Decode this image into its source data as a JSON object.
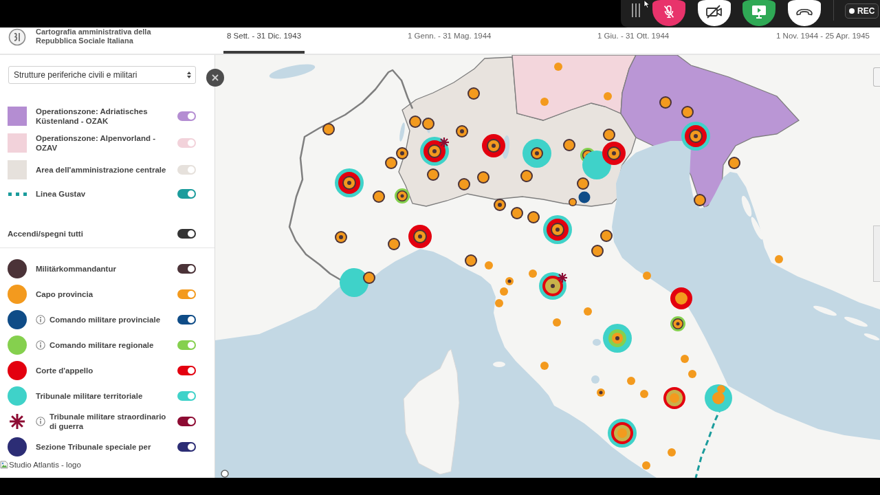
{
  "meeting_toolbar": {
    "mic_muted": true,
    "camera_on": false,
    "screen_sharing": true,
    "recording_label": "REC"
  },
  "header": {
    "title": "Cartografia amministrativa della Repubblica Sociale Italiana",
    "tabs": [
      {
        "label": "8 Sett. - 31 Dic. 1943",
        "selected": true
      },
      {
        "label": "1 Genn. - 31 Mag. 1944",
        "selected": false
      },
      {
        "label": "1 Giu. - 31 Ott. 1944",
        "selected": false
      },
      {
        "label": "1 Nov. 1944 - 25 Apr. 1945",
        "selected": false
      }
    ]
  },
  "sidebar": {
    "dropdown": {
      "value": "Strutture periferiche civili e militari"
    },
    "zones": [
      {
        "kind": "swatch",
        "label": "Operationszone: Adriatisches Küstenland - OZAK",
        "color": "#b48dd2",
        "on": true
      },
      {
        "kind": "swatch",
        "label": "Operationszone: Alpenvorland - OZAV",
        "color": "#f2d2da",
        "on": true
      },
      {
        "kind": "swatch",
        "label": "Area dell'amministrazione centrale",
        "color": "#e6e1dc",
        "on": true
      },
      {
        "kind": "dashes",
        "label": "Linea Gustav",
        "color": "#1b9c9c",
        "on": true
      }
    ],
    "toggle_all": {
      "label": "Accendi/spegni tutti",
      "on": true
    },
    "layers": [
      {
        "kind": "dot",
        "label": "Militärkommandantur",
        "color": "#4b3338",
        "info": false,
        "on": true
      },
      {
        "kind": "dot",
        "label": "Capo provincia",
        "color": "#f39a1e",
        "info": false,
        "on": true
      },
      {
        "kind": "dot",
        "label": "Comando militare provinciale",
        "color": "#0f4c87",
        "info": true,
        "on": true
      },
      {
        "kind": "dot",
        "label": "Comando militare regionale",
        "color": "#85d04e",
        "info": true,
        "on": true
      },
      {
        "kind": "dot",
        "label": "Corte d'appello",
        "color": "#e3000f",
        "info": false,
        "on": true
      },
      {
        "kind": "dot",
        "label": "Tribunale militare territoriale",
        "color": "#3fd2c9",
        "info": false,
        "on": true
      },
      {
        "kind": "asterisk",
        "label": "Tribunale militare straordinario di guerra",
        "color": "#8d0b33",
        "info": true,
        "on": true
      },
      {
        "kind": "dot",
        "label": "Sezione Tribunale speciale per",
        "color": "#2c2d75",
        "info": false,
        "on": true
      }
    ],
    "footer_image_alt": "Studio Atlantis - logo"
  }
}
